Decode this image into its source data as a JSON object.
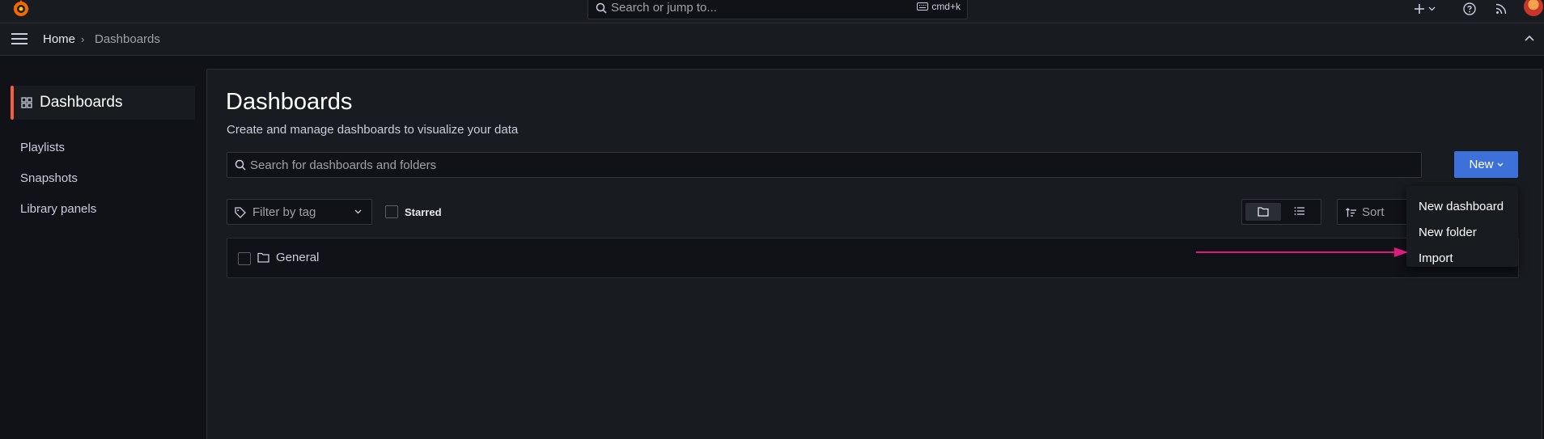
{
  "topbar": {
    "search_placeholder": "Search or jump to...",
    "search_shortcut": "cmd+k"
  },
  "breadcrumb": {
    "home": "Home",
    "separator": "›",
    "current": "Dashboards"
  },
  "sidebar": {
    "active_label": "Dashboards",
    "items": [
      {
        "label": "Playlists"
      },
      {
        "label": "Snapshots"
      },
      {
        "label": "Library panels"
      }
    ]
  },
  "page": {
    "title": "Dashboards",
    "subtitle": "Create and manage dashboards to visualize your data",
    "search_placeholder": "Search for dashboards and folders",
    "new_button": "New",
    "filter_tag": "Filter by tag",
    "starred": "Starred",
    "sort": "Sort"
  },
  "folders": [
    {
      "name": "General"
    }
  ],
  "new_menu": {
    "items": [
      "New dashboard",
      "New folder",
      "Import"
    ]
  },
  "colors": {
    "accent": "#f55f3e",
    "primary_button": "#3d71d9",
    "annotation_arrow": "#e0197d"
  }
}
